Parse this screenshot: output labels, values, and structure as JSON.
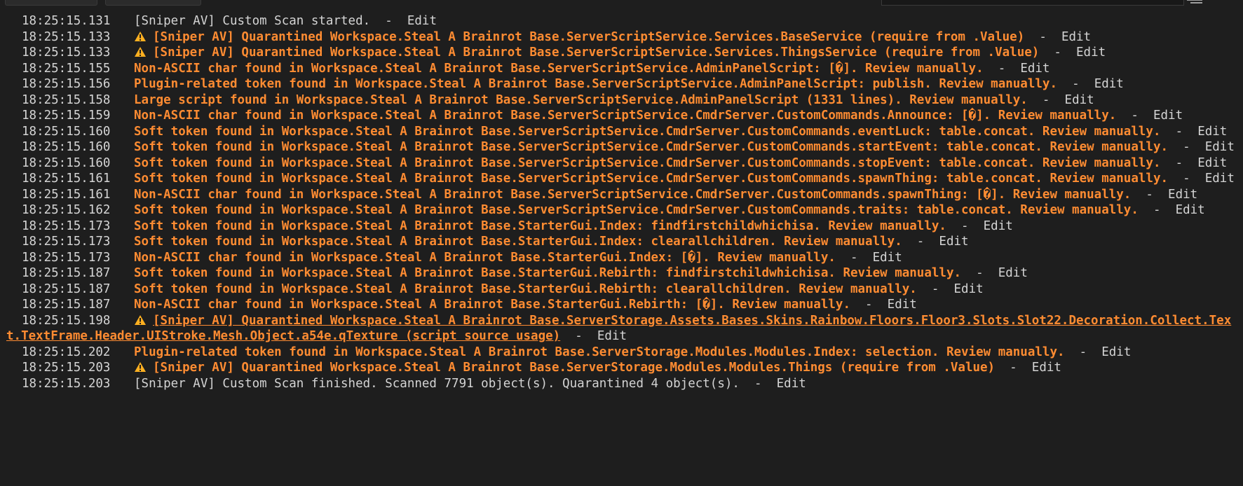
{
  "colors": {
    "background": "#1e1e1e",
    "info_text": "#d4d4d4",
    "warning_text": "#ff8c32",
    "warning_icon": "#ffb020"
  },
  "separator": "  -  ",
  "edit_label": "Edit",
  "lines": [
    {
      "time": "18:25:15.131",
      "kind": "info",
      "text": "[Sniper AV] Custom Scan started."
    },
    {
      "time": "18:25:15.133",
      "kind": "quarantine",
      "text": "[Sniper AV] Quarantined Workspace.Steal A Brainrot Base.ServerScriptService.Services.BaseService (require from .Value)"
    },
    {
      "time": "18:25:15.133",
      "kind": "quarantine",
      "text": "[Sniper AV] Quarantined Workspace.Steal A Brainrot Base.ServerScriptService.Services.ThingsService (require from .Value)"
    },
    {
      "time": "18:25:15.155",
      "kind": "warn",
      "text": "Non-ASCII char found in Workspace.Steal A Brainrot Base.ServerScriptService.AdminPanelScript: [�]. Review manually."
    },
    {
      "time": "18:25:15.156",
      "kind": "warn",
      "text": "Plugin-related token found in Workspace.Steal A Brainrot Base.ServerScriptService.AdminPanelScript: publish. Review manually."
    },
    {
      "time": "18:25:15.158",
      "kind": "warn",
      "text": "Large script found in Workspace.Steal A Brainrot Base.ServerScriptService.AdminPanelScript (1331 lines). Review manually."
    },
    {
      "time": "18:25:15.159",
      "kind": "warn",
      "text": "Non-ASCII char found in Workspace.Steal A Brainrot Base.ServerScriptService.CmdrServer.CustomCommands.Announce: [�]. Review manually."
    },
    {
      "time": "18:25:15.160",
      "kind": "warn",
      "text": "Soft token found in Workspace.Steal A Brainrot Base.ServerScriptService.CmdrServer.CustomCommands.eventLuck: table.concat. Review manually."
    },
    {
      "time": "18:25:15.160",
      "kind": "warn",
      "text": "Soft token found in Workspace.Steal A Brainrot Base.ServerScriptService.CmdrServer.CustomCommands.startEvent: table.concat. Review manually."
    },
    {
      "time": "18:25:15.160",
      "kind": "warn",
      "text": "Soft token found in Workspace.Steal A Brainrot Base.ServerScriptService.CmdrServer.CustomCommands.stopEvent: table.concat. Review manually."
    },
    {
      "time": "18:25:15.161",
      "kind": "warn",
      "text": "Soft token found in Workspace.Steal A Brainrot Base.ServerScriptService.CmdrServer.CustomCommands.spawnThing: table.concat. Review manually."
    },
    {
      "time": "18:25:15.161",
      "kind": "warn",
      "text": "Non-ASCII char found in Workspace.Steal A Brainrot Base.ServerScriptService.CmdrServer.CustomCommands.spawnThing: [�]. Review manually."
    },
    {
      "time": "18:25:15.162",
      "kind": "warn",
      "text": "Soft token found in Workspace.Steal A Brainrot Base.ServerScriptService.CmdrServer.CustomCommands.traits: table.concat. Review manually."
    },
    {
      "time": "18:25:15.173",
      "kind": "warn",
      "text": "Soft token found in Workspace.Steal A Brainrot Base.StarterGui.Index: findfirstchildwhichisa. Review manually."
    },
    {
      "time": "18:25:15.173",
      "kind": "warn",
      "text": "Soft token found in Workspace.Steal A Brainrot Base.StarterGui.Index: clearallchildren. Review manually."
    },
    {
      "time": "18:25:15.173",
      "kind": "warn",
      "text": "Non-ASCII char found in Workspace.Steal A Brainrot Base.StarterGui.Index: [�]. Review manually."
    },
    {
      "time": "18:25:15.187",
      "kind": "warn",
      "text": "Soft token found in Workspace.Steal A Brainrot Base.StarterGui.Rebirth: findfirstchildwhichisa. Review manually."
    },
    {
      "time": "18:25:15.187",
      "kind": "warn",
      "text": "Soft token found in Workspace.Steal A Brainrot Base.StarterGui.Rebirth: clearallchildren. Review manually."
    },
    {
      "time": "18:25:15.187",
      "kind": "warn",
      "text": "Non-ASCII char found in Workspace.Steal A Brainrot Base.StarterGui.Rebirth: [�]. Review manually."
    },
    {
      "time": "18:25:15.198",
      "kind": "quarantine-link",
      "text": "[Sniper AV] Quarantined Workspace.Steal A Brainrot Base.ServerStorage.Assets.Bases.Skins.Rainbow.Floors.Floor3.Slots.Slot22.Decoration.Collect.Text.TextFrame.Header.UIStroke.Mesh.Object.a54e.qTexture (script source usage)"
    },
    {
      "time": "18:25:15.202",
      "kind": "warn",
      "text": "Plugin-related token found in Workspace.Steal A Brainrot Base.ServerStorage.Modules.Modules.Index: selection. Review manually."
    },
    {
      "time": "18:25:15.203",
      "kind": "quarantine",
      "text": "[Sniper AV] Quarantined Workspace.Steal A Brainrot Base.ServerStorage.Modules.Modules.Things (require from .Value)"
    },
    {
      "time": "18:25:15.203",
      "kind": "info",
      "text": "[Sniper AV] Custom Scan finished. Scanned 7791 object(s). Quarantined 4 object(s)."
    }
  ]
}
